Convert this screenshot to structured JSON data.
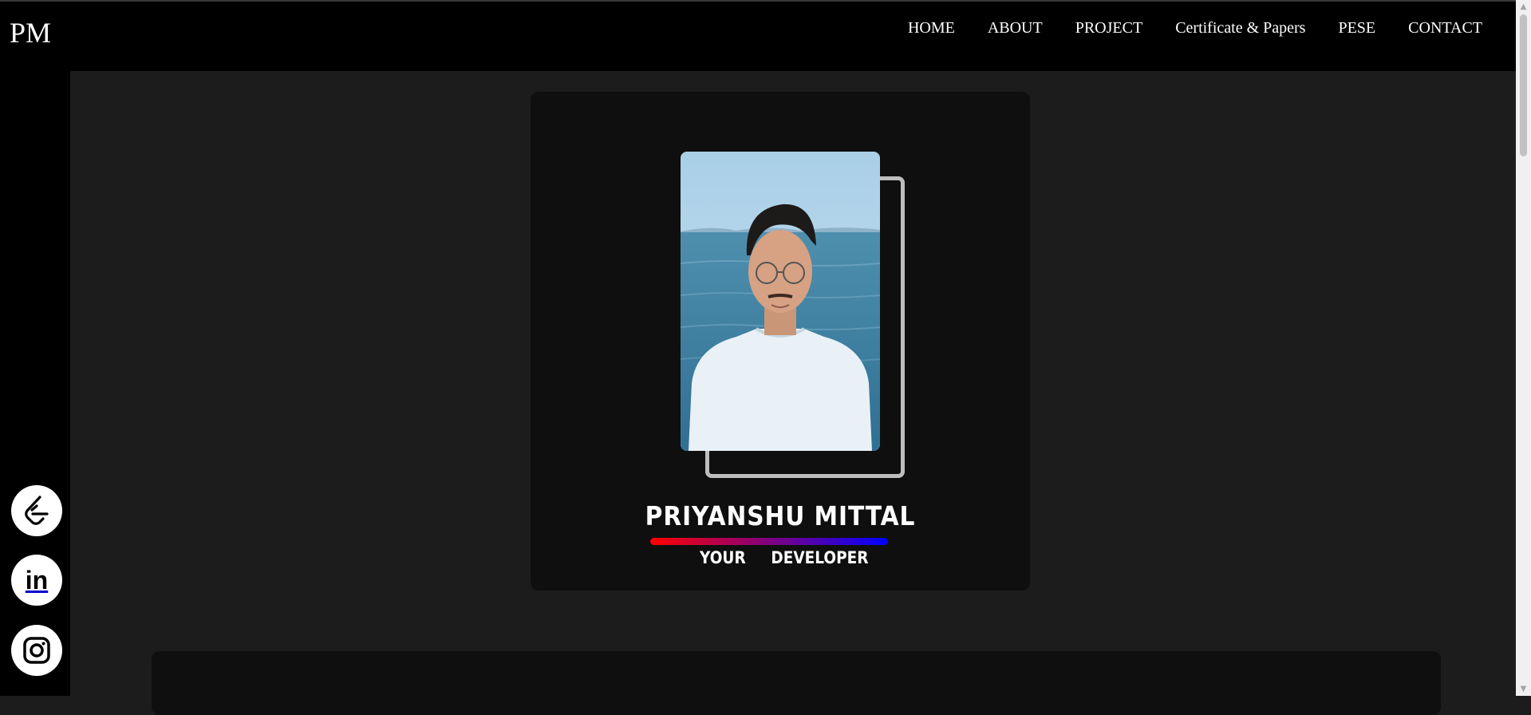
{
  "header": {
    "logo": "PM",
    "nav": [
      "HOME",
      "ABOUT",
      "PROJECT",
      "Certificate & Papers",
      "PESE",
      "CONTACT"
    ]
  },
  "sidebar": {
    "socials": [
      "leetcode-icon",
      "linkedin-icon",
      "instagram-icon"
    ],
    "linkedin_text": "in"
  },
  "hero": {
    "name": "PRIYANSHU MITTAL",
    "subtitle_words": [
      "YOUR",
      "DEVELOPER"
    ],
    "gradient": [
      "#ff0000",
      "#0000ff"
    ]
  },
  "colors": {
    "background": "#1c1c1c",
    "topbar": "#000000",
    "card": "#0f0f0f",
    "frame": "#bdbdbd"
  }
}
